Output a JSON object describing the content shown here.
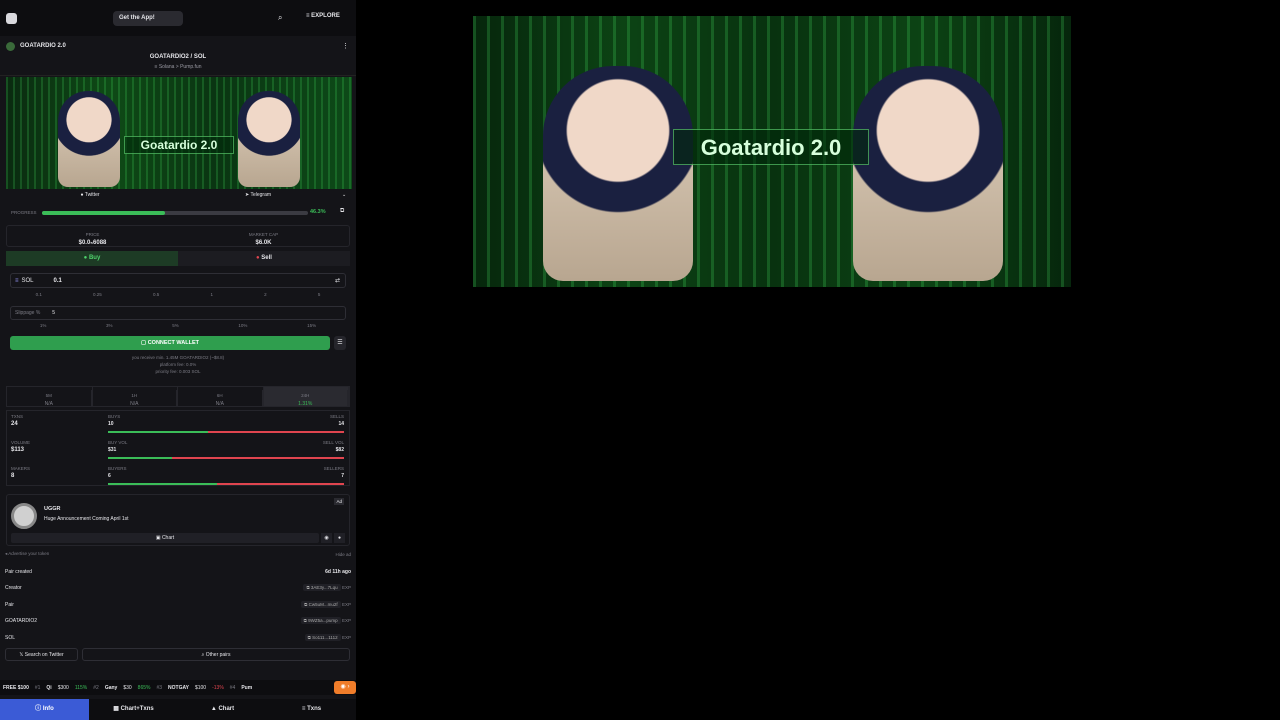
{
  "topbar": {
    "get_app": "Get the App!",
    "explore": "EXPLORE"
  },
  "token": {
    "name": "GOATARDIO 2.0",
    "pair_base": "GOATARDIO2",
    "pair_quote": "SOL",
    "chain": "Solana",
    "dex": "Pump.fun",
    "banner_text": "Goatardio 2.0"
  },
  "socials": {
    "twitter": "Twitter",
    "telegram": "Telegram"
  },
  "progress": {
    "label": "PROGRESS",
    "value": "46.3%",
    "fraction": 0.463
  },
  "price": {
    "price_label": "PRICE",
    "price": "$0.0₅6088",
    "mcap_label": "MARKET CAP",
    "mcap": "$6.0K"
  },
  "trade": {
    "buy": "Buy",
    "sell": "Sell",
    "currency": "SOL",
    "amount": "0.1",
    "amount_chips": [
      "0.1",
      "0.25",
      "0.5",
      "1",
      "2",
      "5"
    ],
    "slippage_label": "Slippage %",
    "slippage": "5",
    "slippage_chips": [
      "1%",
      "3%",
      "5%",
      "10%",
      "15%"
    ],
    "connect": "CONNECT WALLET",
    "receive": "you receive min. 1.45M GOATARDIO2 (~$8.8)",
    "platform_fee": "platform fee: 0.0%",
    "priority_fee": "priority fee: 0.003 SOL"
  },
  "periods": [
    {
      "label": "5M",
      "value": "N/A"
    },
    {
      "label": "1H",
      "value": "N/A"
    },
    {
      "label": "6H",
      "value": "N/A"
    },
    {
      "label": "24H",
      "value": "1.31%"
    }
  ],
  "txstats": {
    "txns_label": "TXNS",
    "txns": "24",
    "buys_label": "BUYS",
    "buys": "10",
    "sells_label": "SELLS",
    "sells": "14",
    "buys_frac": 0.42,
    "volume_label": "VOLUME",
    "volume": "$113",
    "buyvol_label": "BUY VOL",
    "buyvol": "$31",
    "sellvol_label": "SELL VOL",
    "sellvol": "$82",
    "buyvol_frac": 0.27,
    "makers_label": "MAKERS",
    "makers": "8",
    "buyers_label": "BUYERS",
    "buyers": "6",
    "sellers_label": "SELLERS",
    "sellers": "7",
    "buyers_frac": 0.46
  },
  "ad": {
    "tag": "Ad",
    "name": "UGGR",
    "text": "Huge Announcement Coming April 1st",
    "chart": "Chart",
    "advertise": "Advertise your token",
    "hide": "Hide ad"
  },
  "info": [
    {
      "label": "Pair created",
      "value": "6d 11h ago"
    },
    {
      "label": "Creator",
      "value": "3AE3y...7Lqu"
    },
    {
      "label": "Pair",
      "value": "Cw5uM...mu2f"
    },
    {
      "label": "GOATARDIO2",
      "value": "9WZ5a...pump"
    },
    {
      "label": "SOL",
      "value": "So111...1112"
    }
  ],
  "exp": "EXP",
  "buttons": {
    "search_twitter": "Search on Twitter",
    "other_pairs": "Other pairs"
  },
  "ticker": [
    "FREE $100",
    "#1",
    "Qi",
    "$300",
    "115%",
    "#2",
    "Gany",
    "$30",
    "865%",
    "#3",
    "NOTGAY",
    "$100",
    "-13%",
    "#4",
    "Pum"
  ],
  "nav": {
    "info": "Info",
    "chart_txns": "Chart+Txns",
    "chart": "Chart",
    "txns": "Txns"
  },
  "colors": {
    "green": "#3bbd58",
    "red": "#e0454f",
    "accent": "#3b5bd6"
  }
}
